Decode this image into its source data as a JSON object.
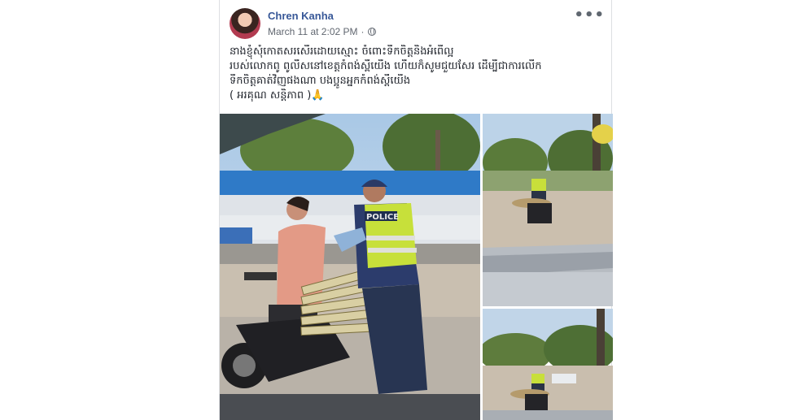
{
  "post": {
    "author": "Chren Kanha",
    "timestamp": "March 11 at 2:02 PM",
    "privacy_icon": "globe-icon",
    "more_icon": "more-options-icon",
    "text_lines": [
      "នាងខ្ញុំសុំកោតសរសើរដោយស្មោះ ចំពោះទឹកចិត្តនិងអំពើល្អ",
      "របស់លោកពូ ពូលីសនៅខេត្តកំពង់ស្ពឺយើង ហើយក៏សូមជួយសែរ ដើម្បីជាការលើក",
      "ទឹកចិត្តគាត់វិញផងណា បងប្អូនអ្នកកំពង់ស្ពឺយើង",
      "( អរគុណ សន្តិភាព )🙏"
    ]
  },
  "photos": {
    "main": {
      "vest_text": "POLICE"
    }
  }
}
